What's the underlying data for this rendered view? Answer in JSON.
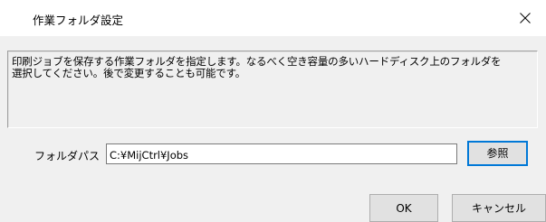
{
  "window": {
    "title": "作業フォルダ設定",
    "close_glyph": "close-icon"
  },
  "description": {
    "text": "印刷ジョブを保存する作業フォルダを指定します。なるべく空き容量の多いハードディスク上のフォルダを\n選択してください。後で変更することも可能です。"
  },
  "folder": {
    "label": "フォルダパス",
    "value": "C:¥MijCtrl¥Jobs"
  },
  "buttons": {
    "browse": "参照",
    "ok": "OK",
    "cancel": "キャンセル"
  },
  "colors": {
    "focus_border": "#0078d7"
  }
}
